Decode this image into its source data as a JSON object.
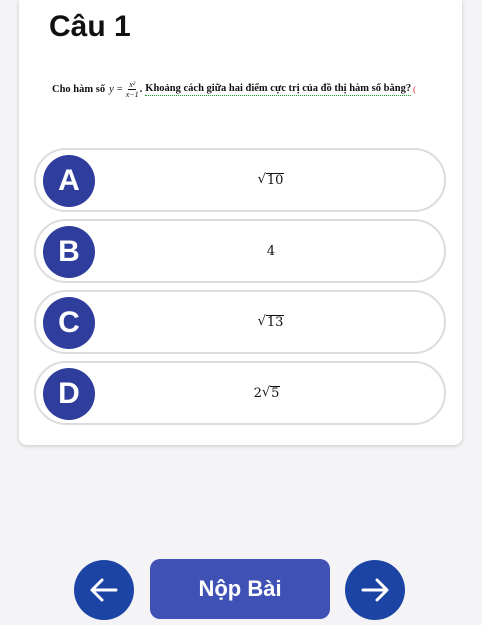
{
  "question": {
    "title": "Câu 1",
    "text_prefix": "Cho hàm số",
    "function_var": "y",
    "equals": "=",
    "numerator": "x²",
    "denominator": "x−1",
    "period": ".",
    "text_suffix": "Khoảng cách giữa hai điểm cực trị của đồ thị hàm số bằng?",
    "trailing_mark": "("
  },
  "options": [
    {
      "letter": "A",
      "coef": "",
      "radicand": "10",
      "plain": ""
    },
    {
      "letter": "B",
      "coef": "",
      "radicand": "",
      "plain": "4"
    },
    {
      "letter": "C",
      "coef": "",
      "radicand": "13",
      "plain": ""
    },
    {
      "letter": "D",
      "coef": "2",
      "radicand": "5",
      "plain": ""
    }
  ],
  "footer": {
    "submit_label": "Nộp Bài",
    "prev_icon": "arrow-left-icon",
    "next_icon": "arrow-right-icon"
  },
  "colors": {
    "badge": "#2f3d9c",
    "nav_button": "#1b44a5",
    "submit_button": "#3f51b5"
  }
}
